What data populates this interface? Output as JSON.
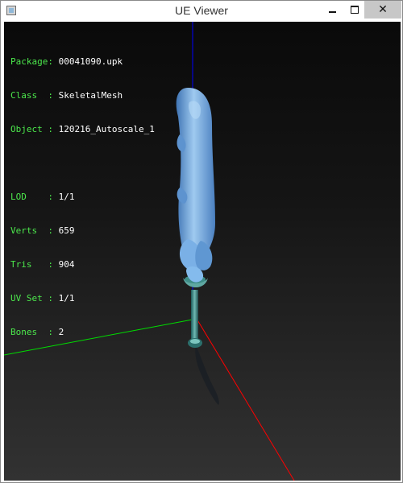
{
  "window": {
    "title": "UE Viewer",
    "icon": "app-window-icon",
    "controls": {
      "minimize": "minimize-icon",
      "maximize": "maximize-icon",
      "close": "close-icon"
    }
  },
  "info": {
    "package": {
      "label": "Package:",
      "value": "00041090.upk"
    },
    "class": {
      "label": "Class  :",
      "value": "SkeletalMesh"
    },
    "object": {
      "label": "Object :",
      "value": "120216_Autoscale_1"
    },
    "lod": {
      "label": "LOD    :",
      "value": "1/1"
    },
    "verts": {
      "label": "Verts  :",
      "value": "659"
    },
    "tris": {
      "label": "Tris   :",
      "value": "904"
    },
    "uvset": {
      "label": "UV Set :",
      "value": "1/1"
    },
    "bones": {
      "label": "Bones  :",
      "value": "2"
    }
  },
  "colors": {
    "axis_x": "#ff0000",
    "axis_y": "#00e000",
    "axis_z": "#0000ff",
    "mesh": "#7fb3e0",
    "info_label": "#4ce84c"
  }
}
